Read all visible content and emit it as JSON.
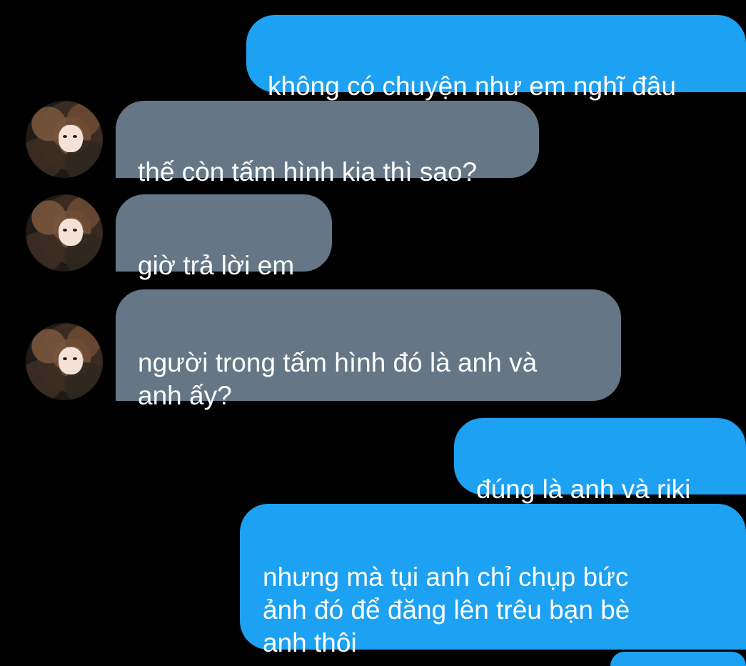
{
  "conversation": {
    "messages": [
      {
        "direction": "sent",
        "text": "không có chuyện như em nghĩ đâu"
      },
      {
        "direction": "received",
        "text": "thế còn tấm hình kia thì sao?",
        "avatar": "contact-avatar"
      },
      {
        "direction": "received",
        "text": "giờ trả lời em",
        "avatar": "contact-avatar"
      },
      {
        "direction": "received",
        "text": "người trong tấm hình đó là anh và\nanh ấy?",
        "avatar": "contact-avatar"
      },
      {
        "direction": "sent",
        "text": "đúng là anh và riki"
      },
      {
        "direction": "sent",
        "text": "nhưng mà tụi anh chỉ chụp bức\nảnh đó để đăng lên trêu bạn bè\nanh thôi"
      }
    ]
  },
  "colors": {
    "background": "#000000",
    "sent_bubble": "#1da1f2",
    "received_bubble": "#657786",
    "text": "#ffffff"
  }
}
